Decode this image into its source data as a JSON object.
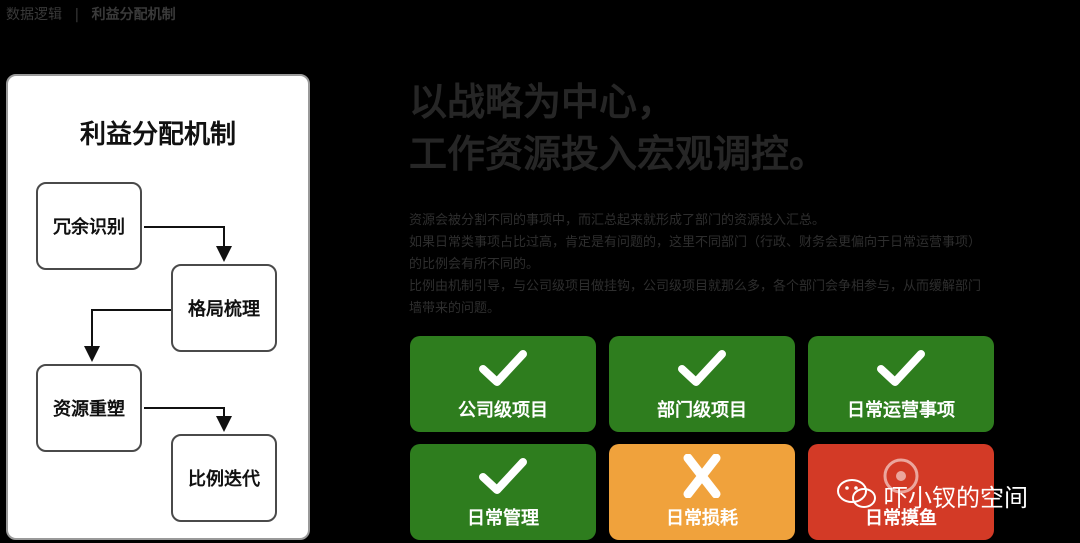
{
  "breadcrumb": {
    "parent": "数据逻辑",
    "separator": "|",
    "current": "利益分配机制"
  },
  "diagram": {
    "title": "利益分配机制",
    "steps": [
      "冗余识别",
      "格局梳理",
      "资源重塑",
      "比例迭代"
    ]
  },
  "headline": {
    "line1": "以战略为中心，",
    "line2": "工作资源投入宏观调控。"
  },
  "description": [
    "资源会被分割不同的事项中，而汇总起来就形成了部门的资源投入汇总。",
    "如果日常类事项占比过高，肯定是有问题的，这里不同部门（行政、财务会更偏向于日常运营事项）",
    "的比例会有所不同的。",
    "比例由机制引导，与公司级项目做挂钩，公司级项目就那么多，各个部门会争相参与，从而缓解部门",
    "墙带来的问题。"
  ],
  "tiles": [
    {
      "label": "公司级项目",
      "icon": "check-icon",
      "color": "#2e7d1e"
    },
    {
      "label": "部门级项目",
      "icon": "check-icon",
      "color": "#2e7d1e"
    },
    {
      "label": "日常运营事项",
      "icon": "check-icon",
      "color": "#2e7d1e"
    },
    {
      "label": "日常管理",
      "icon": "check-icon",
      "color": "#2e7d1e"
    },
    {
      "label": "日常损耗",
      "icon": "cross-icon",
      "color": "#f0a23c"
    },
    {
      "label": "日常摸鱼",
      "icon": "cross-icon",
      "color": "#d33a26"
    }
  ],
  "watermark": {
    "text": "吓小钗的空间",
    "icon": "wechat-icon"
  }
}
